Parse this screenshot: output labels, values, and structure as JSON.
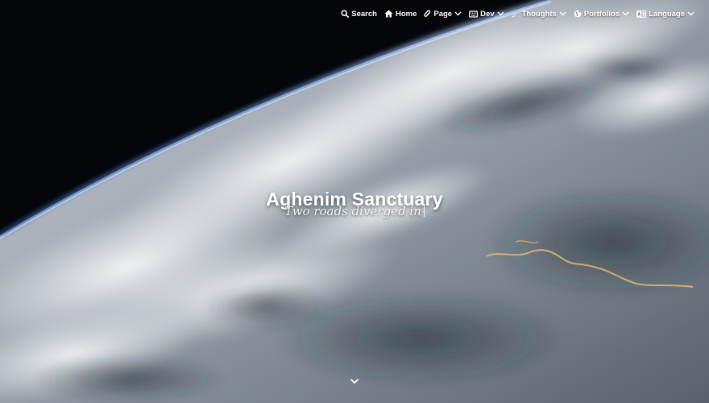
{
  "site": {
    "title": "Aghenim Sanctuary",
    "subtitle": "Two roads diverged in"
  },
  "nav": {
    "items": [
      {
        "label": "Search",
        "icon": "search-icon"
      },
      {
        "label": "Home",
        "icon": "home-icon"
      },
      {
        "label": "Page",
        "icon": "paperclip-icon",
        "dropdown": true
      },
      {
        "label": "Dev",
        "icon": "keyboard-icon",
        "dropdown": true
      },
      {
        "label": "Thoughts",
        "icon": "feather-icon",
        "dropdown": true
      },
      {
        "label": "Portfolios",
        "icon": "globe-icon",
        "dropdown": true
      },
      {
        "label": "Language",
        "icon": "language-icon",
        "dropdown": true
      }
    ]
  },
  "scroll_indicator": {
    "icon": "chevron-down-icon"
  },
  "colors": {
    "text": "#ffffff",
    "space": "#04060a",
    "atmosphere": "#5f8fd6"
  }
}
